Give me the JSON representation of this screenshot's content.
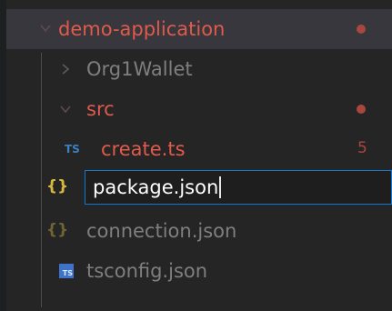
{
  "tree": {
    "root": {
      "label": "demo-application",
      "icon": "chevron-down-icon"
    },
    "items": [
      {
        "label": "Org1Wallet",
        "icon": "chevron-right-icon"
      },
      {
        "label": "src",
        "icon": "chevron-down-icon"
      },
      {
        "label": "create.ts",
        "icon": "typescript-icon",
        "badge": "5"
      },
      {
        "label": "package.json",
        "icon": "json-braces-icon",
        "editing": true
      },
      {
        "label": "connection.json",
        "icon": "json-braces-icon"
      },
      {
        "label": "tsconfig.json",
        "icon": "typescript-config-icon"
      }
    ]
  },
  "icons": {
    "ts_text": "TS",
    "braces_text": "{}",
    "tsconfig_text": "TS"
  },
  "colors": {
    "background": "#252526",
    "selected_row": "#37373d",
    "error_text": "#e05a4b",
    "input_border": "#1177d7",
    "json_icon": "#d7ba3d"
  }
}
